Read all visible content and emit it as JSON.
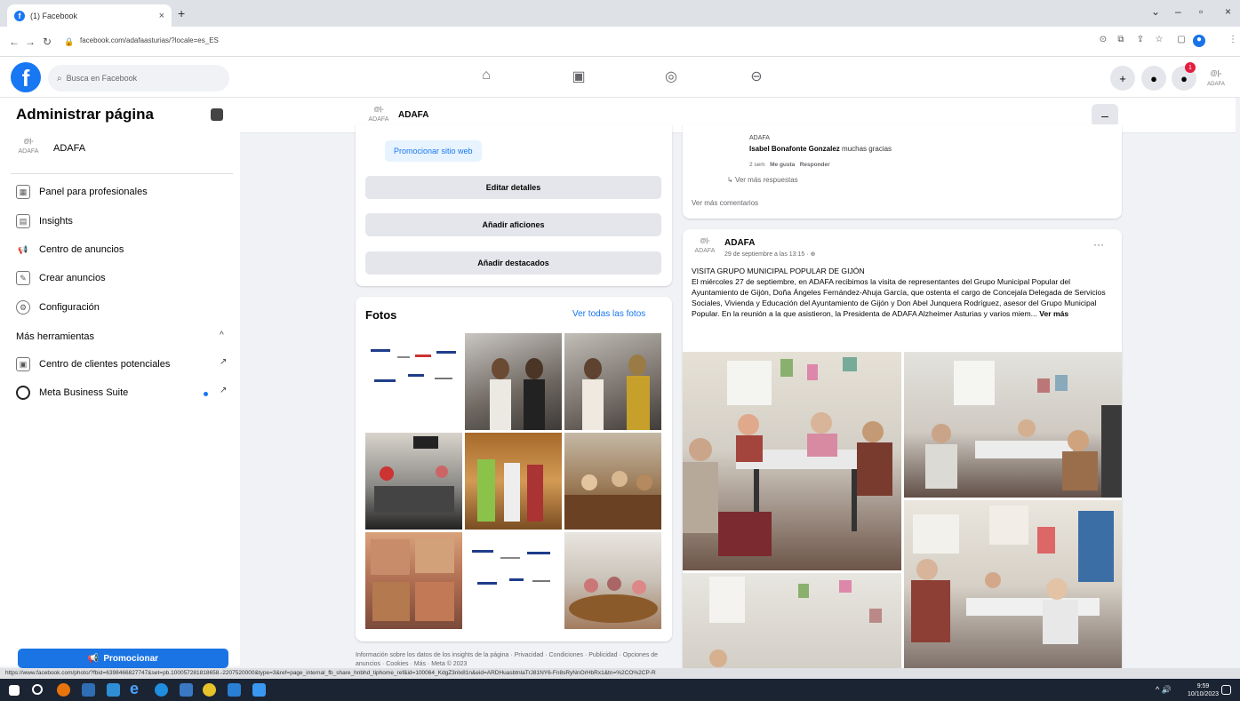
{
  "browser": {
    "tab_title": "(1) Facebook",
    "url": "facebook.com/adafaasturias/?locale=es_ES",
    "status_url": "https://www.facebook.com/photo/?fbid=6398466827747&set=pb.100057281818658.-2207520000&type=3&ref=page_internal_fb_share_hnbhd_tiphome_ref&id=100064_KdgZ3nlx81n&eid=ARDHuasbtnlaTrJ81NY6-Fn8sRyNnOrHbRx1&tn=%2CO%2CP-R"
  },
  "fb": {
    "search_placeholder": "Busca en Facebook",
    "notification_count": "1",
    "avatar_label": "ADAFA"
  },
  "sidebar": {
    "title": "Administrar página",
    "page_name": "ADAFA",
    "items": [
      {
        "label": "Panel para profesionales"
      },
      {
        "label": "Insights"
      },
      {
        "label": "Centro de anuncios"
      },
      {
        "label": "Crear anuncios"
      },
      {
        "label": "Configuración"
      }
    ],
    "more_tools": "Más herramientas",
    "tools": [
      {
        "label": "Centro de clientes potenciales"
      },
      {
        "label": "Meta Business Suite"
      }
    ],
    "promote_label": "Promocionar"
  },
  "pagebar": {
    "name": "ADAFA"
  },
  "intro": {
    "promote_web": "Promocionar sitio web",
    "edit_details": "Editar detalles",
    "add_hobbies": "Añadir aficiones",
    "add_featured": "Añadir destacados"
  },
  "photos": {
    "title": "Fotos",
    "see_all": "Ver todas las fotos"
  },
  "footer": "Información sobre los datos de los insights de la página · Privacidad · Condiciones · Publicidad · Opciones de anuncios · Cookies · Más · Meta © 2023",
  "comments": {
    "author": "ADAFA",
    "reply_name": "Isabel Bonafonte Gonzalez",
    "reply_text": "muchas gracias",
    "reply_time": "2 sem",
    "like": "Me gusta",
    "respond": "Responder",
    "more_replies": "Ver más respuestas",
    "more_comments": "Ver más comentarios"
  },
  "post": {
    "author": "ADAFA",
    "date": "29 de septiembre a las 13:15 ·",
    "headline": "VISITA GRUPO MUNICIPAL POPULAR DE GIJÓN",
    "body": "El miércoles 27 de septiembre, en ADAFA recibimos la visita de representantes del Grupo Municipal Popular del Ayuntamiento de Gijón, Doña Ángeles Fernández-Ahuja García, que ostenta el cargo de Concejala Delegada de Servicios Sociales, Vivienda y Educación del Ayuntamiento de Gijón y Don Abel Junquera Rodríguez, asesor del Grupo Municipal Popular. En la reunión a la que asistieron, la Presidenta de ADAFA Alzheimer Asturias y varios miem...",
    "see_more": "Ver más"
  },
  "taskbar": {
    "time": "9:59",
    "date": "10/10/2023"
  },
  "colors": {
    "fb_blue": "#1877f2",
    "badge_red": "#e41e3f",
    "bg": "#f0f2f5"
  }
}
